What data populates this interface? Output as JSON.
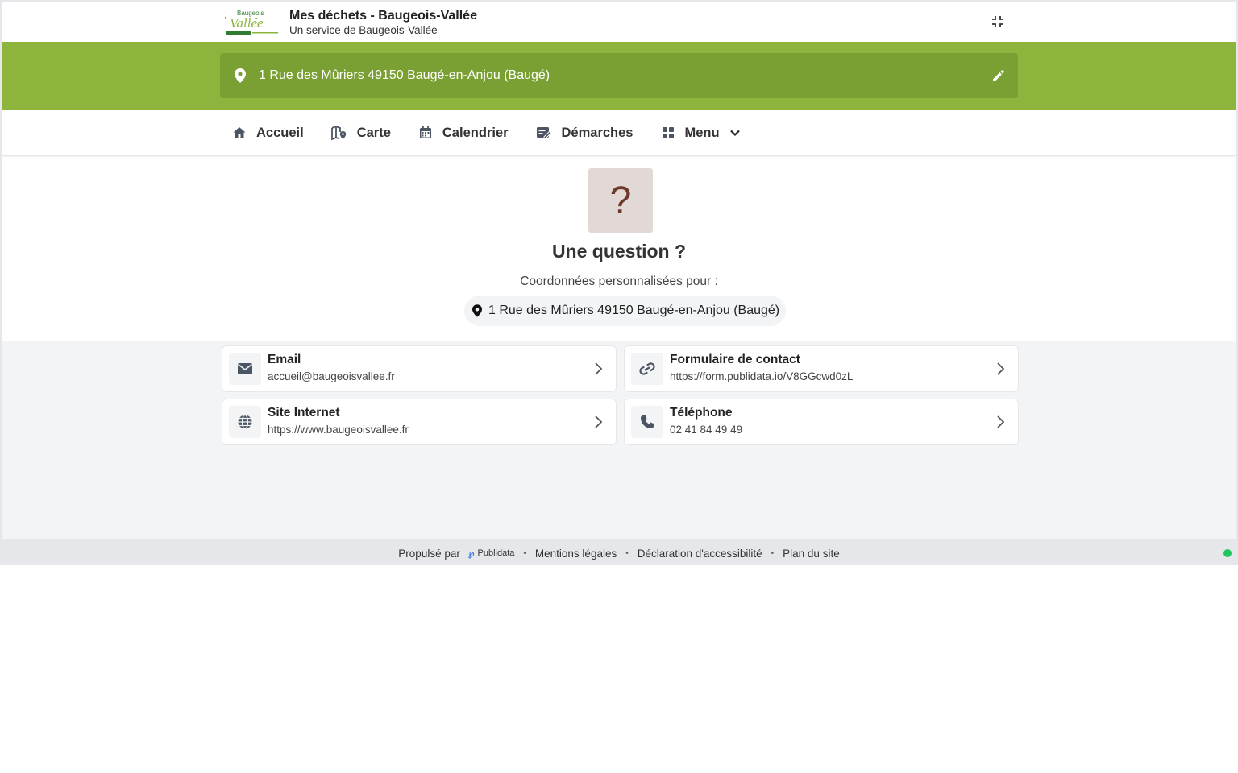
{
  "app": {
    "title": "Mes déchets - Baugeois-Vallée",
    "subtitle": "Un service de Baugeois-Vallée",
    "logo_text_top": "Baugeois",
    "logo_text_main": "Vallée"
  },
  "address": {
    "current": "1 Rue des Mûriers 49150 Baugé-en-Anjou (Baugé)"
  },
  "nav": {
    "items": [
      {
        "label": "Accueil",
        "icon": "home-icon"
      },
      {
        "label": "Carte",
        "icon": "map-icon"
      },
      {
        "label": "Calendrier",
        "icon": "calendar-icon"
      },
      {
        "label": "Démarches",
        "icon": "form-edit-icon"
      },
      {
        "label": "Menu",
        "icon": "grid-icon"
      }
    ]
  },
  "hero": {
    "icon_glyph": "?",
    "title": "Une question ?",
    "subtitle": "Coordonnées personnalisées pour :",
    "address": "1 Rue des Mûriers 49150 Baugé-en-Anjou (Baugé)"
  },
  "contacts": [
    {
      "title": "Email",
      "value": "accueil@baugeoisvallee.fr",
      "icon": "envelope-icon"
    },
    {
      "title": "Formulaire de contact",
      "value": "https://form.publidata.io/V8GGcwd0zL",
      "icon": "link-icon"
    },
    {
      "title": "Site Internet",
      "value": "https://www.baugeoisvallee.fr",
      "icon": "globe-icon"
    },
    {
      "title": "Téléphone",
      "value": "02 41 84 49 49",
      "icon": "phone-icon"
    }
  ],
  "footer": {
    "powered_by": "Propulsé par",
    "brand": "Publidata",
    "legal": "Mentions légales",
    "accessibility": "Déclaration d'accessibilité",
    "sitemap": "Plan du site",
    "sep": "•"
  },
  "colors": {
    "brand_green": "#8db43d",
    "address_bar": "#7a9f33",
    "status_online": "#22c55e"
  }
}
